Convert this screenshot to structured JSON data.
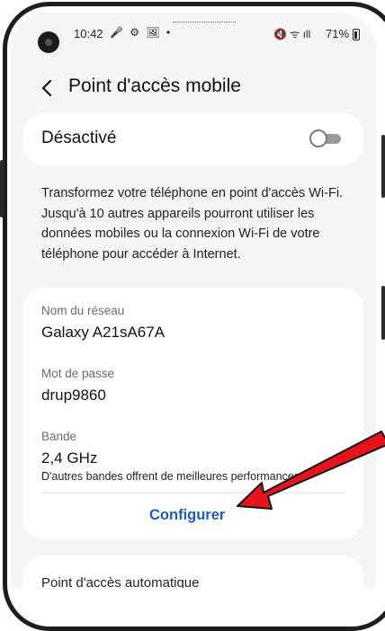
{
  "status_bar": {
    "time": "10:42",
    "left_icons": "🎤 ⚙ 🖼 •",
    "right_icons": "🔇 ᯤ ıll",
    "battery": "71%"
  },
  "header": {
    "title": "Point d'accès mobile"
  },
  "hotspot": {
    "toggle_label": "Désactivé",
    "enabled": false
  },
  "description": "Transformez votre téléphone en point d'accès Wi-Fi. Jusqu'à 10 autres appareils pourront utiliser les données mobiles ou la connexion Wi-Fi de votre téléphone pour accéder à Internet.",
  "network": {
    "name_label": "Nom du réseau",
    "name_value": "Galaxy A21sA67A",
    "password_label": "Mot de passe",
    "password_value": "drup9860",
    "band_label": "Bande",
    "band_value": "2,4 GHz",
    "band_note": "D'autres bandes offrent de meilleures performances...",
    "configure_label": "Configurer"
  },
  "next_item": {
    "label": "Point d'accès automatique"
  },
  "colors": {
    "accent": "#1a5bc8",
    "annotation_arrow": "#e8141c",
    "background": "#f5f5f5",
    "card": "#ffffff"
  }
}
